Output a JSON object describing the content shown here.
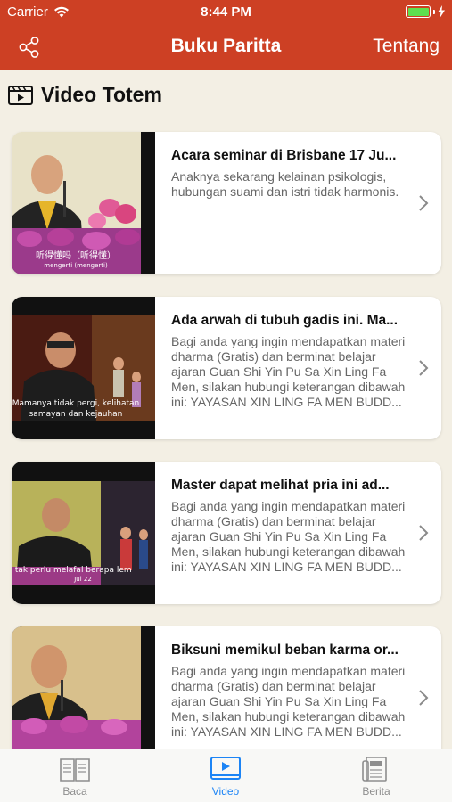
{
  "status_bar": {
    "carrier": "Carrier",
    "time": "8:44 PM"
  },
  "nav": {
    "title": "Buku Paritta",
    "about_label": "Tentang",
    "share_icon": "share-icon"
  },
  "section": {
    "title": "Video Totem",
    "icon": "video-icon"
  },
  "videos": [
    {
      "title": "Acara seminar di Brisbane 17 Ju...",
      "description": "Anaknya sekarang kelainan psikologis, hubungan suami dan istri tidak harmonis.",
      "caption": "听得懂吗（听得懂）",
      "caption2": "mengerti (mengerti)"
    },
    {
      "title": "Ada arwah di tubuh gadis ini. Ma...",
      "description": "Bagi anda yang ingin mendapatkan materi dharma (Gratis) dan berminat belajar ajaran Guan Shi Yin Pu Sa Xin Ling Fa Men, silakan hubungi keterangan dibawah ini: YAYASAN XIN LING FA MEN BUDD...",
      "caption": "Mamanya tidak pergi, kelihatan",
      "caption2": "samayan dan kejauhan"
    },
    {
      "title": "Master dapat melihat pria ini ad...",
      "description": "Bagi anda yang ingin mendapatkan materi dharma (Gratis) dan berminat belajar ajaran Guan Shi Yin Pu Sa Xin Ling Fa Men, silakan hubungi keterangan dibawah ini: YAYASAN XIN LING FA MEN BUDD...",
      "caption": "kok tak perlu melafal berapa lem",
      "caption2": "Jul 22"
    },
    {
      "title": "Biksuni memikul beban karma or...",
      "description": "Bagi anda yang ingin mendapatkan materi dharma (Gratis) dan berminat belajar ajaran Guan Shi Yin Pu Sa Xin Ling Fa Men, silakan hubungi keterangan dibawah ini: YAYASAN XIN LING FA MEN BUDD...",
      "caption": "",
      "caption2": ""
    }
  ],
  "tabs": [
    {
      "label": "Baca",
      "icon": "book-icon",
      "active": false
    },
    {
      "label": "Video",
      "icon": "video-play-icon",
      "active": true
    },
    {
      "label": "Berita",
      "icon": "newspaper-icon",
      "active": false
    }
  ],
  "colors": {
    "brand": "#cd4024",
    "background": "#f3efe4",
    "tab_active": "#1c84f5",
    "tab_inactive": "#8e8e8e"
  }
}
